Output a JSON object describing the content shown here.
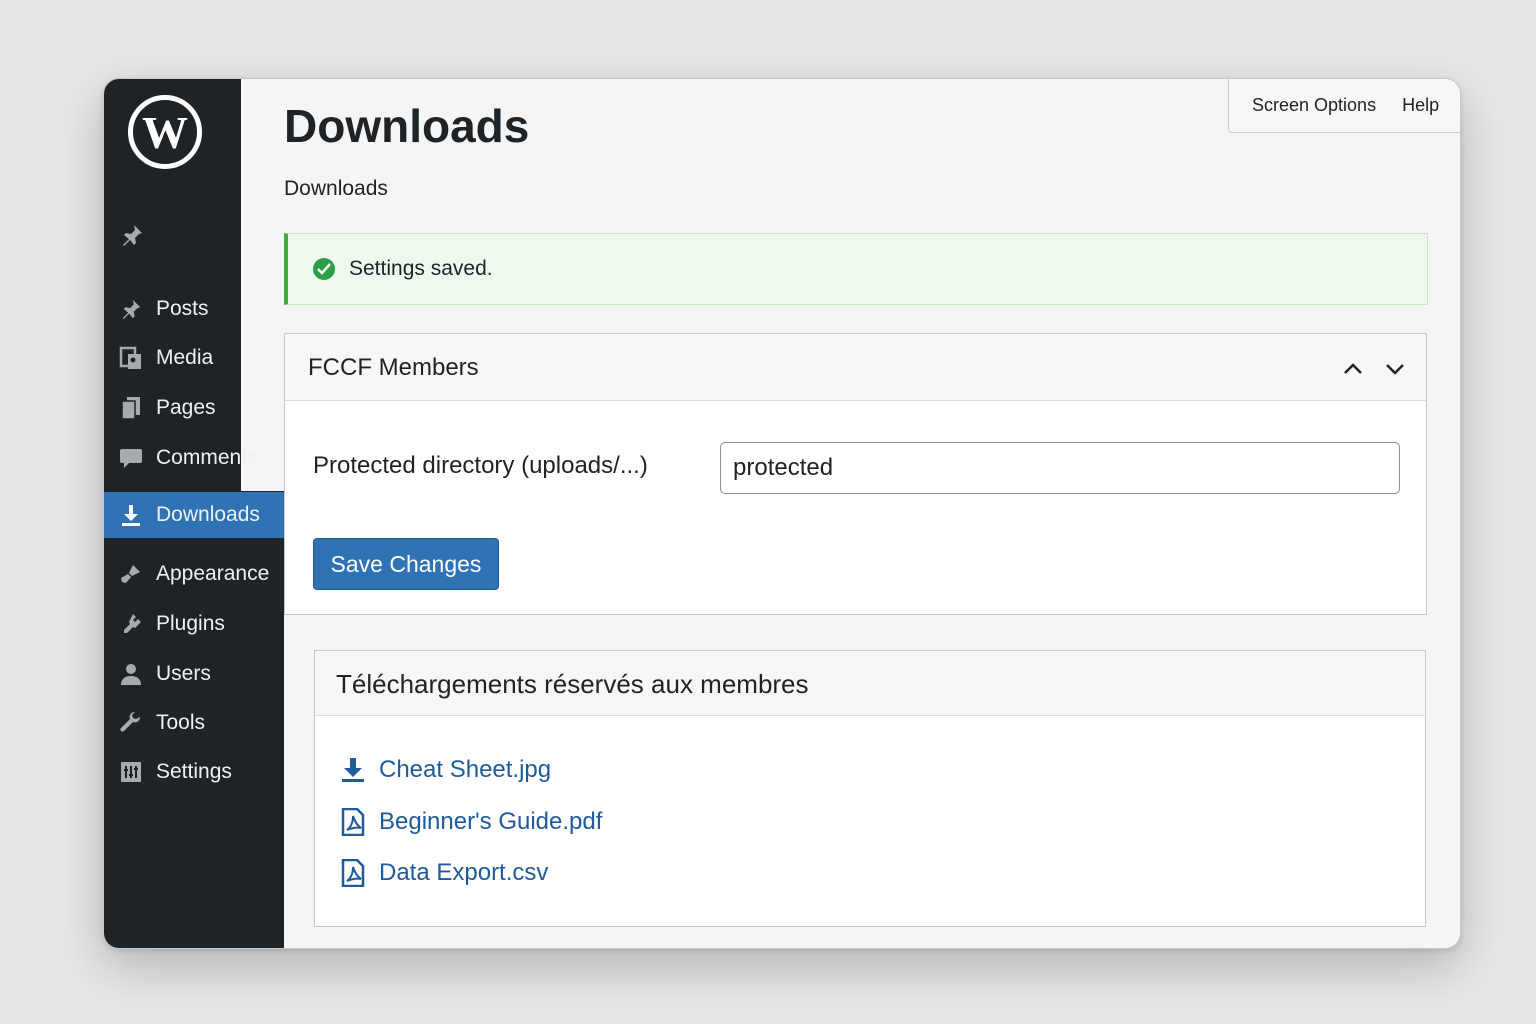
{
  "page": {
    "title": "Downloads",
    "subtitle": "Downloads"
  },
  "screen_tabs": {
    "screen_options": "Screen Options",
    "help": "Help"
  },
  "sidebar": {
    "items": [
      {
        "label": "Posts",
        "icon": "pin-icon"
      },
      {
        "label": "Media",
        "icon": "media-icon"
      },
      {
        "label": "Pages",
        "icon": "pages-icon"
      },
      {
        "label": "Comments",
        "icon": "comment-icon"
      },
      {
        "label": "Downloads",
        "icon": "download-icon",
        "active": true
      },
      {
        "label": "Appearance",
        "icon": "brush-icon"
      },
      {
        "label": "Plugins",
        "icon": "plugin-icon"
      },
      {
        "label": "Users",
        "icon": "user-icon"
      },
      {
        "label": "Tools",
        "icon": "wrench-icon"
      },
      {
        "label": "Settings",
        "icon": "settings-icon"
      }
    ]
  },
  "notice": {
    "text": "Settings saved."
  },
  "members_panel": {
    "title": "FCCF Members",
    "field_label": "Protected directory (uploads/...)",
    "field_value": "protected",
    "save_label": "Save Changes"
  },
  "downloads_box": {
    "title": "Téléchargements réservés aux membres",
    "files": [
      {
        "name": "Cheat Sheet.jpg",
        "icon": "download-icon"
      },
      {
        "name": "Beginner's Guide.pdf",
        "icon": "pdf-icon"
      },
      {
        "name": "Data Export.csv",
        "icon": "pdf-icon"
      }
    ]
  },
  "colors": {
    "sidebar_bg": "#1e2328",
    "accent": "#2f73b5",
    "success": "#2d9f47",
    "link": "#1f5a9c"
  }
}
